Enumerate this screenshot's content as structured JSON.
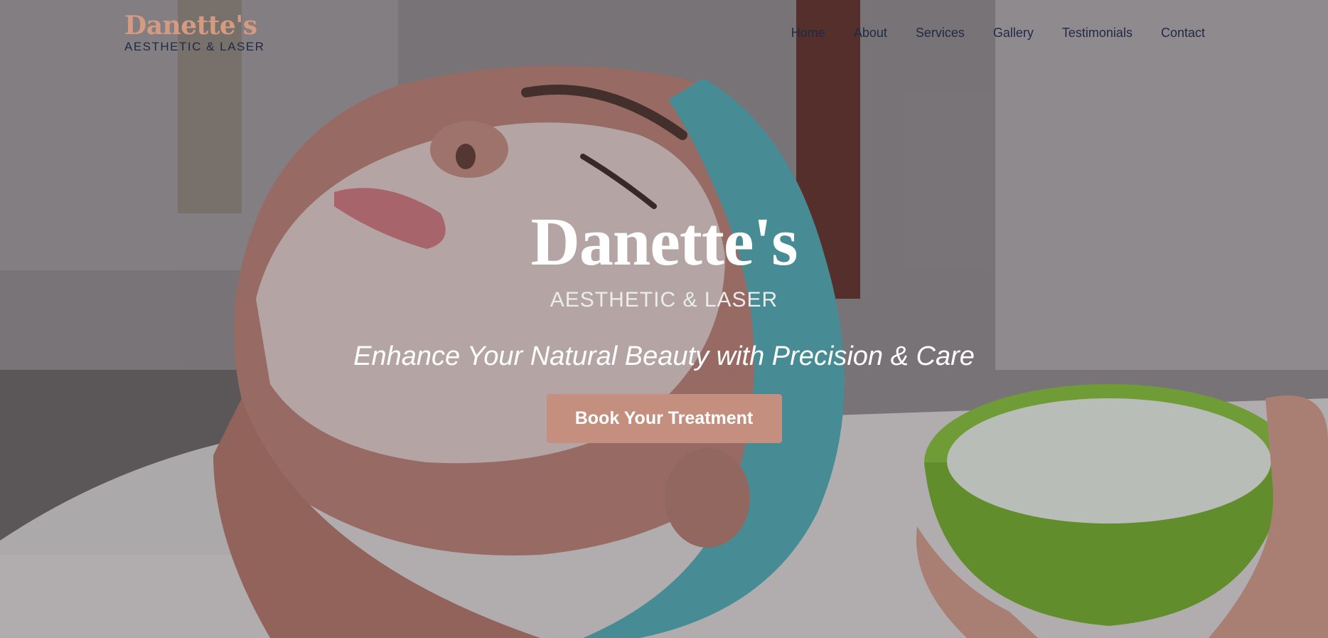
{
  "header": {
    "logo": {
      "name": "Danette's",
      "tagline": "AESTHETIC & LASER"
    },
    "nav": [
      {
        "label": "Home"
      },
      {
        "label": "About"
      },
      {
        "label": "Services"
      },
      {
        "label": "Gallery"
      },
      {
        "label": "Testimonials"
      },
      {
        "label": "Contact"
      }
    ]
  },
  "hero": {
    "title": "Danette's",
    "subtitle": "AESTHETIC & LASER",
    "tagline": "Enhance Your Natural Beauty with Precision & Care",
    "cta_label": "Book Your Treatment",
    "background_image": "woman receiving facial mask treatment with green bowl of cream"
  },
  "colors": {
    "brand_accent": "#c48f7f",
    "nav_text": "#1f2a44",
    "logo_name": "#d49a82",
    "logo_tag": "#1f2a44",
    "hero_text": "#ffffff"
  }
}
